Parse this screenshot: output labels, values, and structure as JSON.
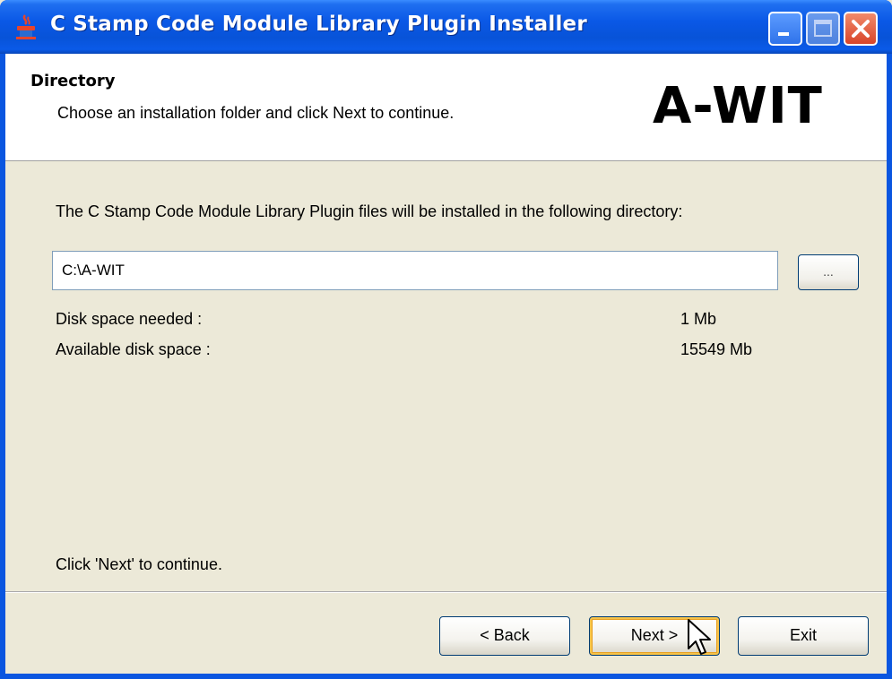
{
  "window": {
    "title": "C Stamp Code Module Library Plugin Installer"
  },
  "header": {
    "title": "Directory",
    "subtitle": "Choose an installation folder and click Next to continue.",
    "logo_text": "A-WIT"
  },
  "body": {
    "description": "The C Stamp Code Module Library Plugin files will be installed in the following directory:",
    "directory_value": "C:\\A-WIT",
    "browse_label": "...",
    "disk_needed_label": "Disk space needed :",
    "disk_needed_value": "1 Mb",
    "disk_available_label": "Available disk space :",
    "disk_available_value": "15549 Mb",
    "footer_hint": "Click 'Next' to continue."
  },
  "buttons": {
    "back": "< Back",
    "next": "Next >",
    "exit": "Exit"
  },
  "icons": {
    "app": "java-installer-icon",
    "minimize": "minimize-icon",
    "maximize": "maximize-icon",
    "close": "close-icon",
    "cursor": "mouse-pointer-icon"
  }
}
